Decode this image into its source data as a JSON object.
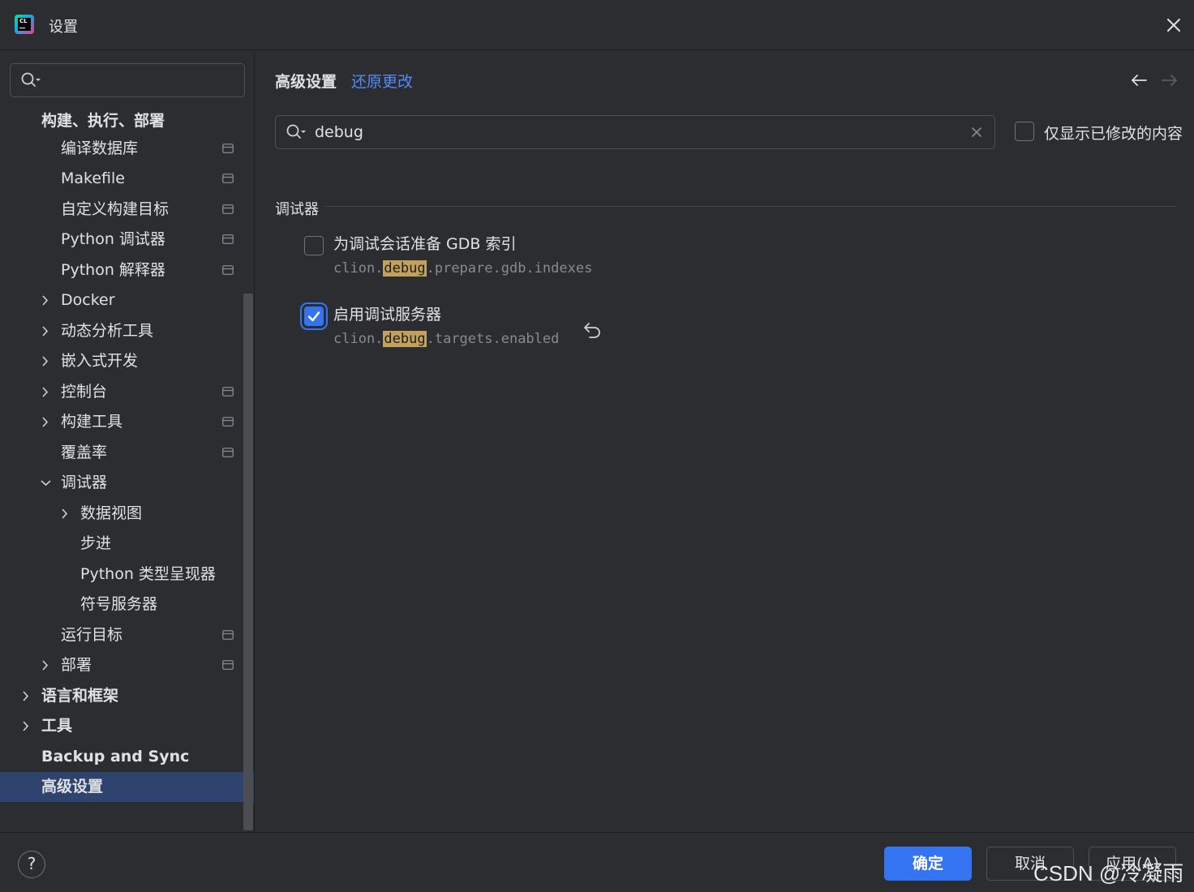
{
  "window": {
    "title": "设置",
    "logo_text": "CL"
  },
  "sidebar": {
    "search_placeholder": "",
    "items": [
      {
        "label": "构建、执行、部署"
      },
      {
        "label": "编译数据库"
      },
      {
        "label": "Makefile"
      },
      {
        "label": "自定义构建目标"
      },
      {
        "label": "Python 调试器"
      },
      {
        "label": "Python 解释器"
      },
      {
        "label": "Docker"
      },
      {
        "label": "动态分析工具"
      },
      {
        "label": "嵌入式开发"
      },
      {
        "label": "控制台"
      },
      {
        "label": "构建工具"
      },
      {
        "label": "覆盖率"
      },
      {
        "label": "调试器"
      },
      {
        "label": "数据视图"
      },
      {
        "label": "步进"
      },
      {
        "label": "Python 类型呈现器"
      },
      {
        "label": "符号服务器"
      },
      {
        "label": "运行目标"
      },
      {
        "label": "部署"
      },
      {
        "label": "语言和框架"
      },
      {
        "label": "工具"
      },
      {
        "label": "Backup and Sync"
      },
      {
        "label": "高级设置"
      }
    ]
  },
  "main": {
    "title": "高级设置",
    "reset_link": "还原更改",
    "filter": {
      "value": "debug"
    },
    "modified_only_label": "仅显示已修改的内容",
    "section": {
      "title": "调试器",
      "options": [
        {
          "label": "为调试会话准备 GDB 索引",
          "key_prefix": "clion.",
          "key_match": "debug",
          "key_suffix": ".prepare.gdb.indexes",
          "checked": false
        },
        {
          "label": "启用调试服务器",
          "key_prefix": "clion.",
          "key_match": "debug",
          "key_suffix": ".targets.enabled",
          "checked": true
        }
      ]
    }
  },
  "footer": {
    "help_label": "?",
    "ok_label": "确定",
    "cancel_label": "取消",
    "apply_label": "应用(A)"
  },
  "watermark": "CSDN @冷凝雨",
  "colors": {
    "background": "#2b2d30",
    "accent": "#3574f0",
    "link": "#548af7",
    "selection": "#2e436e",
    "highlight": "#c4a15b"
  }
}
